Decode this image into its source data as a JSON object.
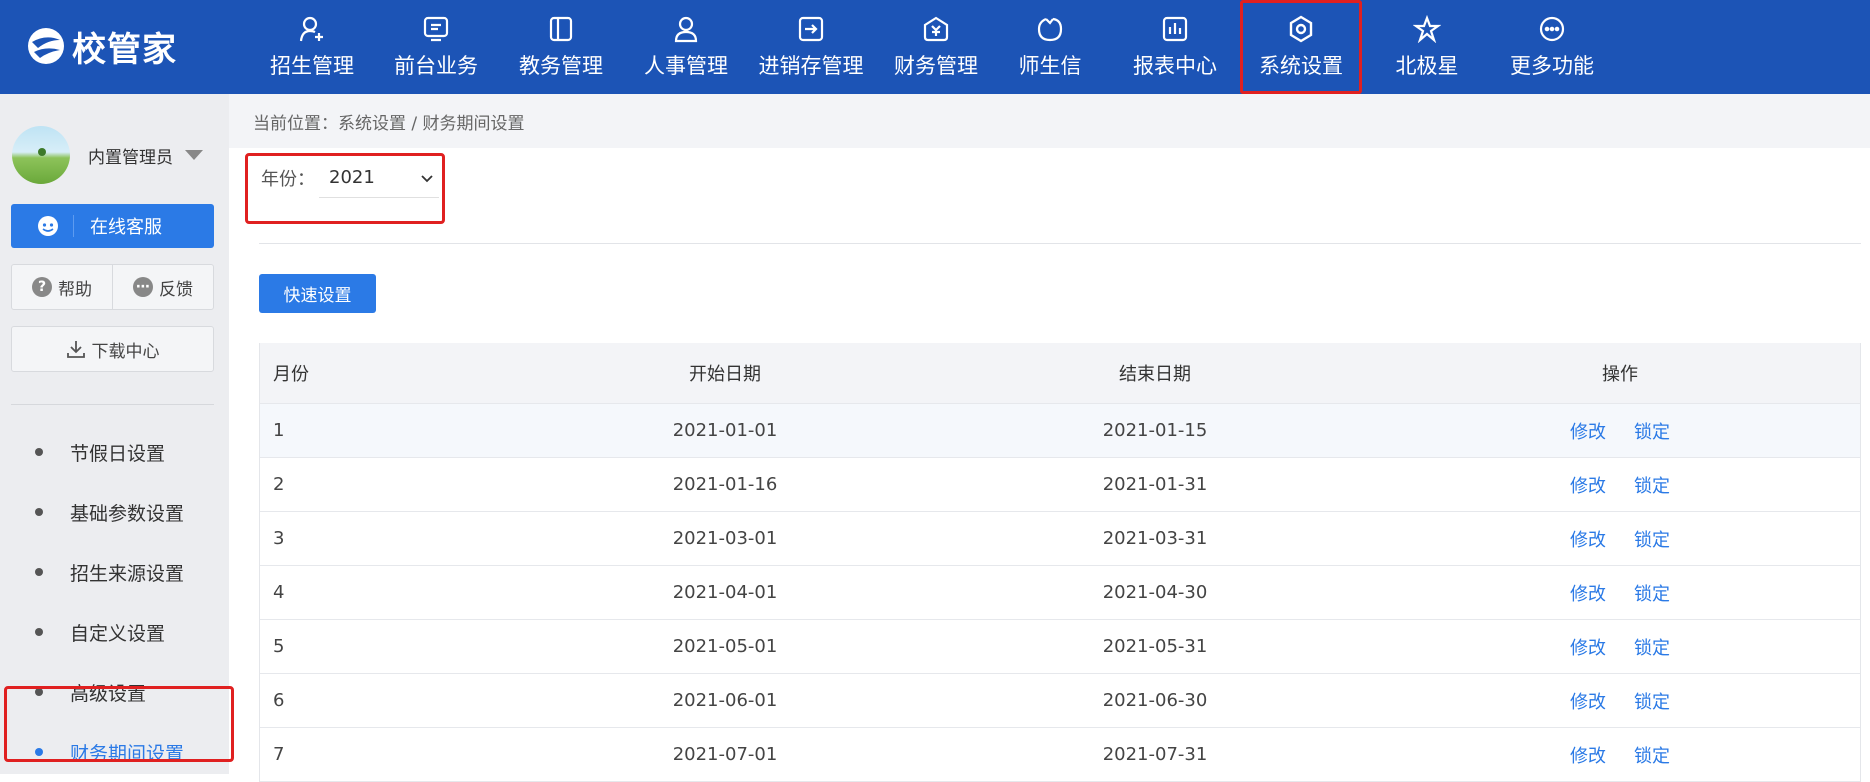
{
  "brand": {
    "name": "校管家",
    "color": "#1c54b6"
  },
  "nav": [
    {
      "label": "招生管理",
      "icon": "user-add-icon"
    },
    {
      "label": "前台业务",
      "icon": "monitor-icon"
    },
    {
      "label": "教务管理",
      "icon": "book-icon"
    },
    {
      "label": "人事管理",
      "icon": "person-icon"
    },
    {
      "label": "进销存管理",
      "icon": "arrow-box-icon"
    },
    {
      "label": "财务管理",
      "icon": "money-shield-icon"
    },
    {
      "label": "师生信",
      "icon": "chat-circle-icon"
    },
    {
      "label": "报表中心",
      "icon": "bar-chart-icon"
    },
    {
      "label": "系统设置",
      "icon": "settings-hex-icon",
      "active": true
    },
    {
      "label": "北极星",
      "icon": "polaris-star-icon"
    },
    {
      "label": "更多功能",
      "icon": "more-dots-icon"
    }
  ],
  "sidebar": {
    "user_name": "内置管理员",
    "customer_service": "在线客服",
    "help": "帮助",
    "feedback": "反馈",
    "download_center": "下载中心",
    "menu": [
      {
        "label": "节假日设置"
      },
      {
        "label": "基础参数设置"
      },
      {
        "label": "招生来源设置"
      },
      {
        "label": "自定义设置"
      },
      {
        "label": "高级设置"
      },
      {
        "label": "财务期间设置",
        "active": true
      }
    ]
  },
  "breadcrumb": {
    "prefix": "当前位置：",
    "path": "系统设置 / 财务期间设置"
  },
  "filter": {
    "year_label": "年份：",
    "year_value": "2021"
  },
  "quick_setting_label": "快速设置",
  "table": {
    "headers": {
      "month": "月份",
      "start": "开始日期",
      "end": "结束日期",
      "op": "操作"
    },
    "edit_label": "修改",
    "lock_label": "锁定",
    "rows": [
      {
        "month": "1",
        "start": "2021-01-01",
        "end": "2021-01-15"
      },
      {
        "month": "2",
        "start": "2021-01-16",
        "end": "2021-01-31"
      },
      {
        "month": "3",
        "start": "2021-03-01",
        "end": "2021-03-31"
      },
      {
        "month": "4",
        "start": "2021-04-01",
        "end": "2021-04-30"
      },
      {
        "month": "5",
        "start": "2021-05-01",
        "end": "2021-05-31"
      },
      {
        "month": "6",
        "start": "2021-06-01",
        "end": "2021-06-30"
      },
      {
        "month": "7",
        "start": "2021-07-01",
        "end": "2021-07-31"
      }
    ]
  },
  "colors": {
    "accent": "#2b7ae6",
    "highlight": "#e02020",
    "sidebar_bg": "#ecedf0"
  }
}
